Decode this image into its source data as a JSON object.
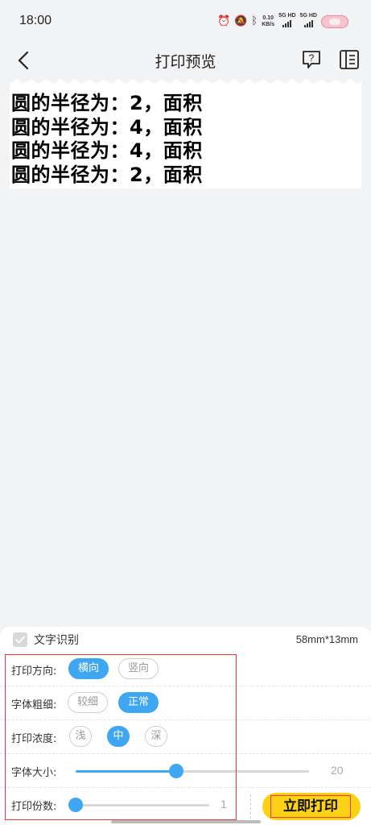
{
  "status_bar": {
    "time": "18:00",
    "net_speed": "0.10",
    "net_unit": "KB/s",
    "sig1": "5G HD",
    "sig2": "5G HD"
  },
  "header": {
    "title": "打印预览"
  },
  "preview": {
    "lines": [
      "圆的半径为：2，面积",
      "圆的半径为：4，面积",
      "圆的半径为：4，面积",
      "圆的半径为：2，面积"
    ]
  },
  "panel": {
    "ocr_label": "文字识别",
    "ocr_checked": true,
    "paper_size": "58mm*13mm",
    "direction": {
      "label": "打印方向:",
      "options": [
        "横向",
        "竖向"
      ],
      "selected": "横向"
    },
    "weight": {
      "label": "字体粗细:",
      "options": [
        "较细",
        "正常"
      ],
      "selected": "正常"
    },
    "density": {
      "label": "打印浓度:",
      "options": [
        "浅",
        "中",
        "深"
      ],
      "selected": "中"
    },
    "font_size": {
      "label": "字体大小:",
      "value": "20",
      "fraction": 0.43
    },
    "copies": {
      "label": "打印份数:",
      "value": "1",
      "fraction": 0.0
    },
    "print_button": "立即打印"
  },
  "colors": {
    "accent": "#3fa7f1",
    "print_button": "#fcd116",
    "highlight": "#e53935"
  }
}
